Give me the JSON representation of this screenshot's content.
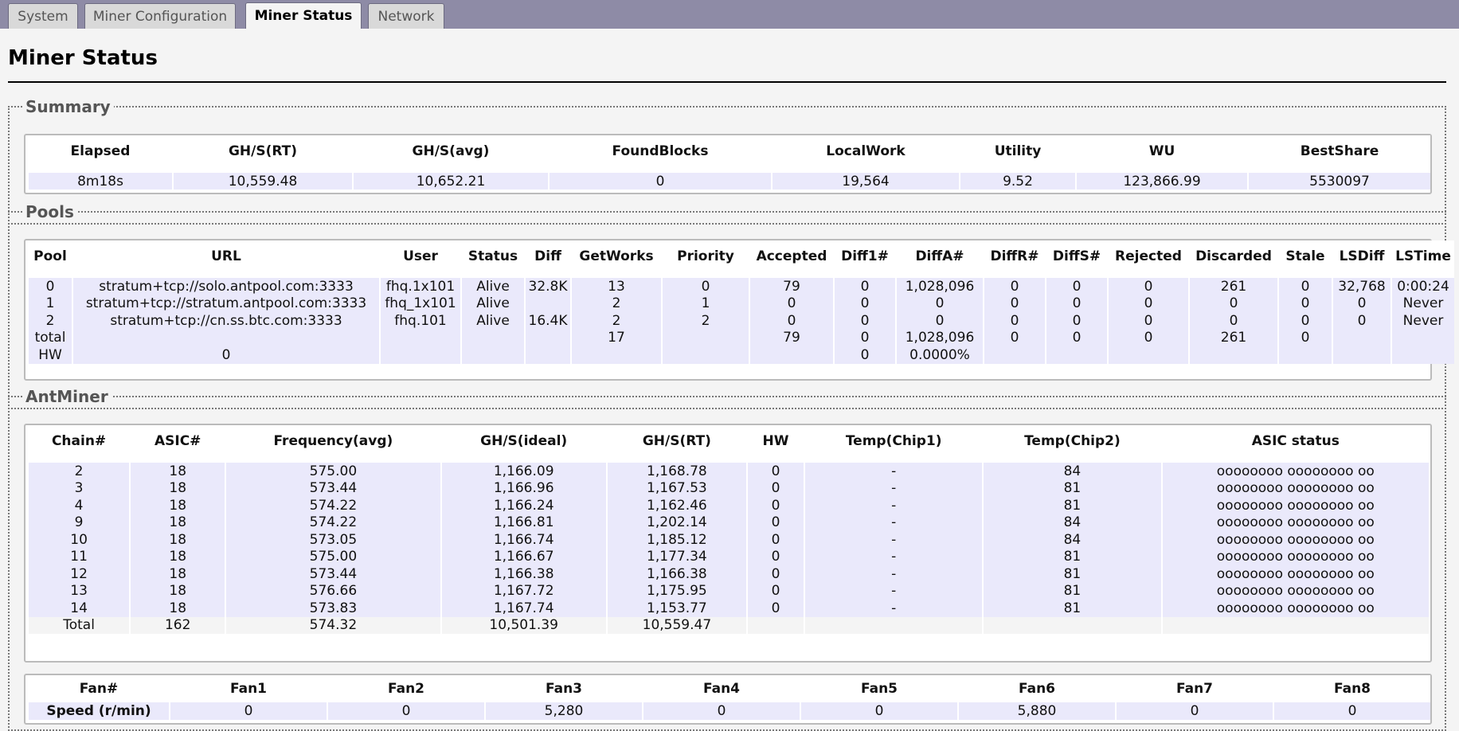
{
  "tabs": [
    {
      "label": "System",
      "active": false
    },
    {
      "label": "Miner Configuration",
      "active": false
    },
    {
      "label": "Miner Status",
      "active": true
    },
    {
      "label": "Network",
      "active": false
    }
  ],
  "page_title": "Miner Status",
  "summary": {
    "legend": "Summary",
    "headers": [
      "Elapsed",
      "GH/S(RT)",
      "GH/S(avg)",
      "FoundBlocks",
      "LocalWork",
      "Utility",
      "WU",
      "BestShare"
    ],
    "values": [
      "8m18s",
      "10,559.48",
      "10,652.21",
      "0",
      "19,564",
      "9.52",
      "123,866.99",
      "5530097"
    ]
  },
  "pools": {
    "legend": "Pools",
    "headers": [
      "Pool",
      "URL",
      "User",
      "Status",
      "Diff",
      "GetWorks",
      "Priority",
      "Accepted",
      "Diff1#",
      "DiffA#",
      "DiffR#",
      "DiffS#",
      "Rejected",
      "Discarded",
      "Stale",
      "LSDiff",
      "LSTime"
    ],
    "rows": [
      [
        "0",
        "stratum+tcp://solo.antpool.com:3333",
        "fhq.1x101",
        "Alive",
        "32.8K",
        "13",
        "0",
        "79",
        "0",
        "1,028,096",
        "0",
        "0",
        "0",
        "261",
        "0",
        "32,768",
        "0:00:24"
      ],
      [
        "1",
        "stratum+tcp://stratum.antpool.com:3333",
        "fhq_1x101",
        "Alive",
        "",
        "2",
        "1",
        "0",
        "0",
        "0",
        "0",
        "0",
        "0",
        "0",
        "0",
        "0",
        "Never"
      ],
      [
        "2",
        "stratum+tcp://cn.ss.btc.com:3333",
        "fhq.101",
        "Alive",
        "16.4K",
        "2",
        "2",
        "0",
        "0",
        "0",
        "0",
        "0",
        "0",
        "0",
        "0",
        "0",
        "Never"
      ],
      [
        "total",
        "",
        "",
        "",
        "",
        "17",
        "",
        "79",
        "0",
        "1,028,096",
        "0",
        "0",
        "0",
        "261",
        "0",
        "",
        ""
      ],
      [
        "HW",
        "0",
        "",
        "",
        "",
        "",
        "",
        "",
        "0",
        "0.0000%",
        "",
        "",
        "",
        "",
        "",
        "",
        ""
      ]
    ]
  },
  "antminer": {
    "legend": "AntMiner",
    "headers": [
      "Chain#",
      "ASIC#",
      "Frequency(avg)",
      "GH/S(ideal)",
      "GH/S(RT)",
      "HW",
      "Temp(Chip1)",
      "Temp(Chip2)",
      "ASIC status"
    ],
    "rows": [
      [
        "2",
        "18",
        "575.00",
        "1,166.09",
        "1,168.78",
        "0",
        "-",
        "84",
        "oooooooo oooooooo oo"
      ],
      [
        "3",
        "18",
        "573.44",
        "1,166.96",
        "1,167.53",
        "0",
        "-",
        "81",
        "oooooooo oooooooo oo"
      ],
      [
        "4",
        "18",
        "574.22",
        "1,166.24",
        "1,162.46",
        "0",
        "-",
        "81",
        "oooooooo oooooooo oo"
      ],
      [
        "9",
        "18",
        "574.22",
        "1,166.81",
        "1,202.14",
        "0",
        "-",
        "84",
        "oooooooo oooooooo oo"
      ],
      [
        "10",
        "18",
        "573.05",
        "1,166.74",
        "1,185.12",
        "0",
        "-",
        "84",
        "oooooooo oooooooo oo"
      ],
      [
        "11",
        "18",
        "575.00",
        "1,166.67",
        "1,177.34",
        "0",
        "-",
        "81",
        "oooooooo oooooooo oo"
      ],
      [
        "12",
        "18",
        "573.44",
        "1,166.38",
        "1,166.38",
        "0",
        "-",
        "81",
        "oooooooo oooooooo oo"
      ],
      [
        "13",
        "18",
        "576.66",
        "1,167.72",
        "1,175.95",
        "0",
        "-",
        "81",
        "oooooooo oooooooo oo"
      ],
      [
        "14",
        "18",
        "573.83",
        "1,167.74",
        "1,153.77",
        "0",
        "-",
        "81",
        "oooooooo oooooooo oo"
      ],
      [
        "Total",
        "162",
        "574.32",
        "10,501.39",
        "10,559.47",
        "",
        "",
        "",
        ""
      ]
    ],
    "fans": {
      "headers": [
        "Fan#",
        "Fan1",
        "Fan2",
        "Fan3",
        "Fan4",
        "Fan5",
        "Fan6",
        "Fan7",
        "Fan8"
      ],
      "values": [
        "Speed (r/min)",
        "0",
        "0",
        "5,280",
        "0",
        "0",
        "5,880",
        "0",
        "0"
      ]
    }
  },
  "colors": {
    "frame": "#8e8ba6",
    "page_bg": "#f4f4f4",
    "row_fill": "#eae9fb",
    "legend_text": "#555555"
  }
}
